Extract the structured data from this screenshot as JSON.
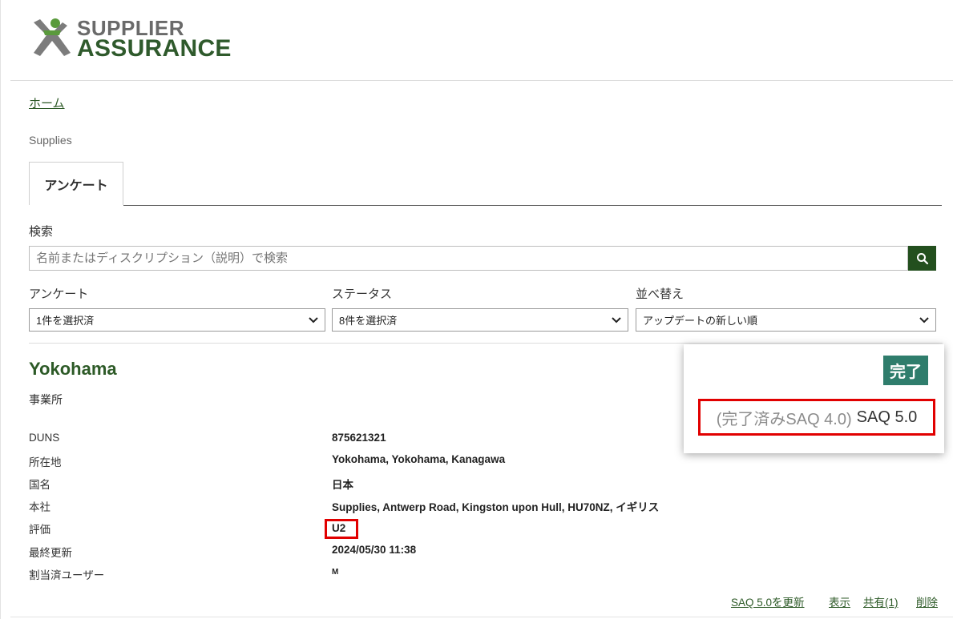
{
  "logo": {
    "line1": "SUPPLIER",
    "line2": "ASSURANCE"
  },
  "breadcrumb": {
    "home": "ホーム",
    "current": "Supplies"
  },
  "tabs": [
    {
      "label": "アンケート",
      "active": true
    }
  ],
  "search": {
    "label": "検索",
    "placeholder": "名前またはディスクリプション（説明）で検索",
    "icon": "search-icon"
  },
  "filters": [
    {
      "label": "アンケート",
      "value": "1件を選択済"
    },
    {
      "label": "ステータス",
      "value": "8件を選択済"
    },
    {
      "label": "並べ替え",
      "value": "アップデートの新しい順"
    }
  ],
  "location": {
    "name": "Yokohama",
    "type": "事業所",
    "fields": [
      {
        "label": "DUNS",
        "value": "875621321"
      },
      {
        "label": "所在地",
        "value": "Yokohama, Yokohama, Kanagawa"
      },
      {
        "label": "国名",
        "value": "日本"
      },
      {
        "label": "本社",
        "value": "Supplies, Antwerp Road, Kingston upon Hull, HU70NZ, イギリス"
      },
      {
        "label": "評価",
        "value": "U2"
      },
      {
        "label": "最終更新",
        "value": "2024/05/30 11:38"
      },
      {
        "label": "割当済ユーザー",
        "value": "M"
      }
    ]
  },
  "status_card": {
    "badge": "完了",
    "previous": "(完了済みSAQ 4.0)",
    "current": "SAQ 5.0"
  },
  "actions": {
    "update": "SAQ 5.0を更新",
    "view": "表示",
    "share": "共有(1)",
    "delete": "削除"
  },
  "colors": {
    "brand_green": "#2d5a27",
    "search_button": "#234f1e",
    "badge": "#2f7d6c",
    "highlight": "#e10000"
  }
}
